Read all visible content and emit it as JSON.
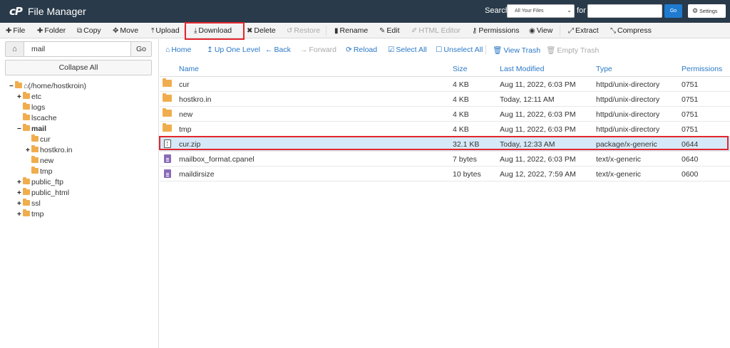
{
  "header": {
    "logo": "cP",
    "title": "File Manager",
    "search_label": "Search",
    "search_scope": "All Your Files",
    "for_label": "for",
    "search_value": "",
    "go_label": "Go",
    "settings_label": "Settings"
  },
  "toolbar": {
    "file": "File",
    "folder": "Folder",
    "copy": "Copy",
    "move": "Move",
    "upload": "Upload",
    "download": "Download",
    "delete": "Delete",
    "restore": "Restore",
    "rename": "Rename",
    "edit": "Edit",
    "html_editor": "HTML Editor",
    "permissions": "Permissions",
    "view": "View",
    "extract": "Extract",
    "compress": "Compress"
  },
  "sidebar": {
    "path_value": "mail",
    "go_label": "Go",
    "collapse_label": "Collapse All",
    "tree": [
      {
        "toggle": "−",
        "label": "(/home/hostkroin)"
      },
      {
        "toggle": "+",
        "label": "etc"
      },
      {
        "toggle": "",
        "label": "logs"
      },
      {
        "toggle": "",
        "label": "lscache"
      },
      {
        "toggle": "−",
        "label": "mail"
      },
      {
        "toggle": "",
        "label": "cur"
      },
      {
        "toggle": "+",
        "label": "hostkro.in"
      },
      {
        "toggle": "",
        "label": "new"
      },
      {
        "toggle": "",
        "label": "tmp"
      },
      {
        "toggle": "+",
        "label": "public_ftp"
      },
      {
        "toggle": "+",
        "label": "public_html"
      },
      {
        "toggle": "+",
        "label": "ssl"
      },
      {
        "toggle": "+",
        "label": "tmp"
      }
    ]
  },
  "nav": {
    "home": "Home",
    "up_one_level": "Up One Level",
    "back": "Back",
    "forward": "Forward",
    "reload": "Reload",
    "select_all": "Select All",
    "unselect_all": "Unselect All",
    "view_trash": "View Trash",
    "empty_trash": "Empty Trash"
  },
  "table": {
    "columns": [
      "Name",
      "Size",
      "Last Modified",
      "Type",
      "Permissions"
    ],
    "rows": [
      {
        "icon": "folder-icon",
        "name": "cur",
        "size": "4 KB",
        "modified": "Aug 11, 2022, 6:03 PM",
        "type": "httpd/unix-directory",
        "perms": "0751"
      },
      {
        "icon": "folder-icon",
        "name": "hostkro.in",
        "size": "4 KB",
        "modified": "Today, 12:11 AM",
        "type": "httpd/unix-directory",
        "perms": "0751"
      },
      {
        "icon": "folder-icon",
        "name": "new",
        "size": "4 KB",
        "modified": "Aug 11, 2022, 6:03 PM",
        "type": "httpd/unix-directory",
        "perms": "0751"
      },
      {
        "icon": "folder-icon",
        "name": "tmp",
        "size": "4 KB",
        "modified": "Aug 11, 2022, 6:03 PM",
        "type": "httpd/unix-directory",
        "perms": "0751"
      },
      {
        "icon": "zip-file-icon",
        "name": "cur.zip",
        "size": "32.1 KB",
        "modified": "Today, 12:33 AM",
        "type": "package/x-generic",
        "perms": "0644"
      },
      {
        "icon": "text-file-icon",
        "name": "mailbox_format.cpanel",
        "size": "7 bytes",
        "modified": "Aug 11, 2022, 6:03 PM",
        "type": "text/x-generic",
        "perms": "0640"
      },
      {
        "icon": "text-file-icon",
        "name": "maildirsize",
        "size": "10 bytes",
        "modified": "Aug 12, 2022, 7:59 AM",
        "type": "text/x-generic",
        "perms": "0600"
      }
    ]
  },
  "colors": {
    "header_bg": "#293a4a",
    "link_blue": "#2a78c6",
    "selected_row": "#d6e9f8",
    "highlight_red": "#e3262c",
    "folder": "#f0ad4e"
  }
}
